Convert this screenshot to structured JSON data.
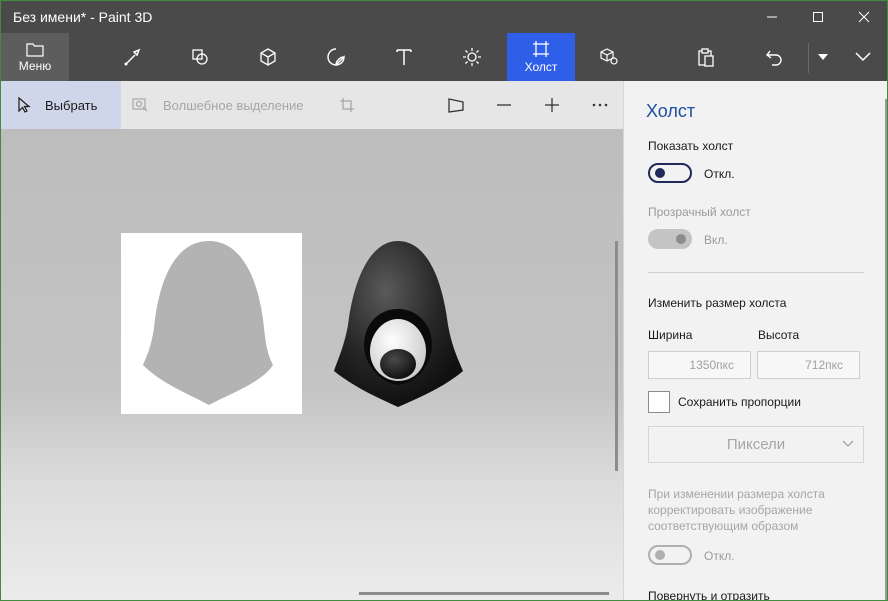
{
  "window": {
    "title": "Без имени* - Paint 3D"
  },
  "ribbon": {
    "menu_label": "Меню",
    "active_tool_label": "Холст",
    "tools": [
      "brushes-icon",
      "2d-shapes-icon",
      "3d-shapes-icon",
      "stickers-icon",
      "text-icon",
      "effects-icon",
      "canvas-icon",
      "3d-library-icon"
    ],
    "accent": "#2f5ee8"
  },
  "toolbar": {
    "select_label": "Выбрать",
    "magic_select_label": "Волшебное выделение"
  },
  "panel": {
    "title": "Холст",
    "show_canvas_label": "Показать холст",
    "show_canvas_state": "Откл.",
    "transparent_label": "Прозрачный холст",
    "transparent_state": "Вкл.",
    "resize_label": "Изменить размер холста",
    "width_label": "Ширина",
    "height_label": "Высота",
    "width_value": "1350пкс",
    "height_value": "712пкс",
    "keep_ratio_label": "Сохранить пропорции",
    "units_value": "Пиксели",
    "resize_note": "При изменении размера холста корректировать изображение соответствующим образом",
    "resize_note_state": "Откл.",
    "rotate_label": "Повернуть и отразить"
  }
}
